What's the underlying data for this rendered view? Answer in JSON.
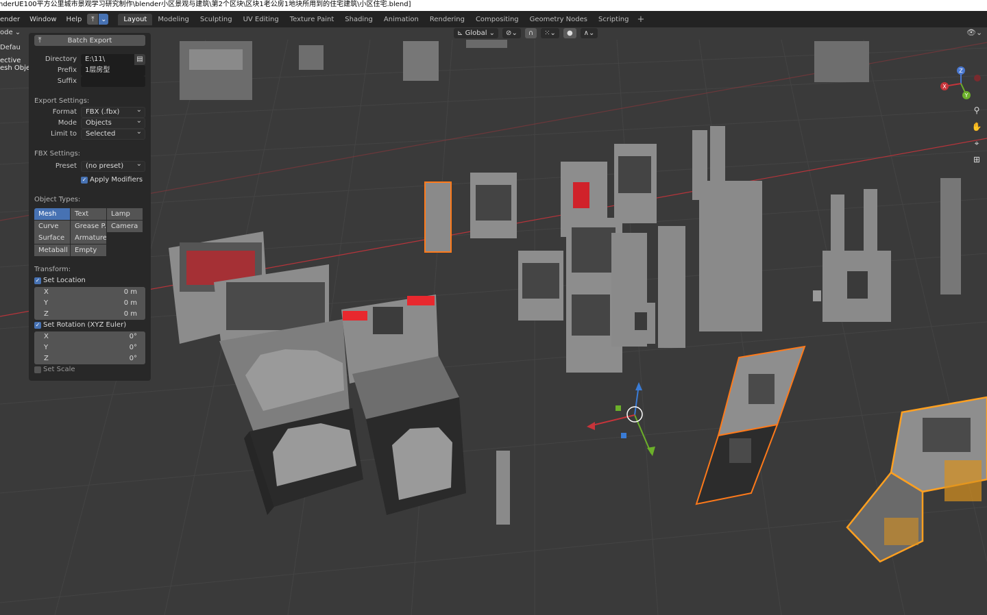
{
  "window_title": "nderUE100平方公里城市景观学习研究制作\\blender小区景观与建筑\\第2个区块\\区块1老公房1地块所用到的住宅建筑\\小区住宅.blend]",
  "menubar": {
    "render": "ender",
    "window": "Window",
    "help": "Help"
  },
  "workspace_tabs": [
    "Layout",
    "Modeling",
    "Sculpting",
    "UV Editing",
    "Texture Paint",
    "Shading",
    "Animation",
    "Rendering",
    "Compositing",
    "Geometry Nodes",
    "Scripting"
  ],
  "active_tab": "Layout",
  "add_tab_label": "+",
  "viewport_header": {
    "mode": "ode",
    "orientation": "Global"
  },
  "outliner_peek": [
    "Defau",
    "ective",
    "esh Objec"
  ],
  "batch_export": {
    "header": "Batch Export",
    "directory_label": "Directory",
    "directory_value": "E:\\11\\",
    "prefix_label": "Prefix",
    "prefix_value": "1层房型",
    "suffix_label": "Suffix",
    "suffix_value": "",
    "export_settings_label": "Export Settings:",
    "format_label": "Format",
    "format_value": "FBX (.fbx)",
    "mode_label": "Mode",
    "mode_value": "Objects",
    "limit_label": "Limit to",
    "limit_value": "Selected",
    "fbx_settings_label": "FBX Settings:",
    "preset_label": "Preset",
    "preset_value": "(no preset)",
    "apply_modifiers_label": "Apply Modifiers",
    "apply_modifiers_checked": true,
    "object_types_label": "Object Types:",
    "object_types": [
      [
        "Mesh",
        "Text",
        "Lamp"
      ],
      [
        "Curve",
        "Grease P...",
        "Camera"
      ],
      [
        "Surface",
        "Armature"
      ],
      [
        "Metaball",
        "Empty"
      ]
    ],
    "transform_label": "Transform:",
    "set_location_label": "Set Location",
    "set_location_checked": true,
    "location": [
      {
        "axis": "X",
        "value": "0 m"
      },
      {
        "axis": "Y",
        "value": "0 m"
      },
      {
        "axis": "Z",
        "value": "0 m"
      }
    ],
    "set_rotation_label": "Set Rotation (XYZ Euler)",
    "set_rotation_checked": true,
    "rotation": [
      {
        "axis": "X",
        "value": "0°"
      },
      {
        "axis": "Y",
        "value": "0°"
      },
      {
        "axis": "Z",
        "value": "0°"
      }
    ],
    "set_scale_label": "Set Scale",
    "set_scale_checked": false
  },
  "gizmo_axes": {
    "x": "X",
    "y": "Y",
    "z": "Z"
  },
  "colors": {
    "accent": "#4772b3",
    "selection_outline": "#ff7a1a",
    "active_outline": "#ffa020",
    "grid_red_axis": "#b8343a",
    "viewport_bg": "#3a3a3a"
  }
}
